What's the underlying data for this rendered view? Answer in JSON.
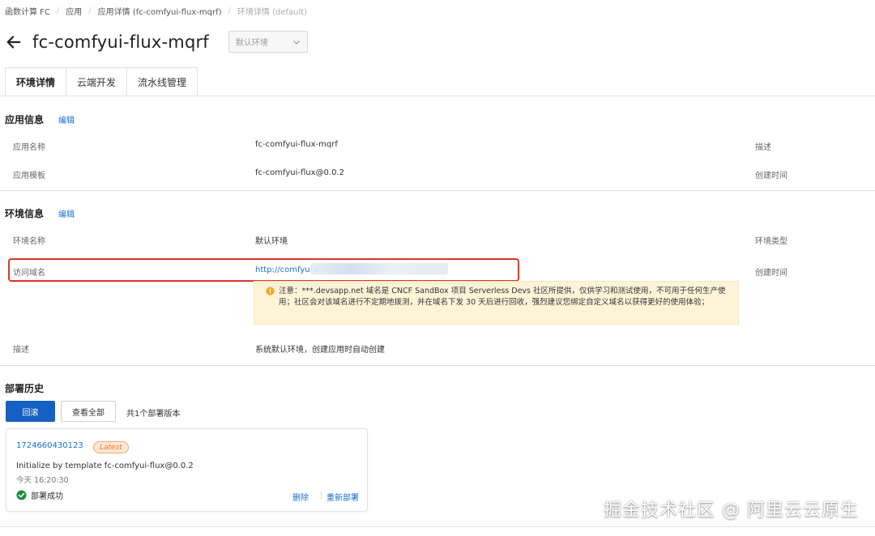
{
  "breadcrumb": {
    "items": [
      "函数计算 FC",
      "应用",
      "应用详情 (fc-comfyui-flux-mqrf)"
    ],
    "current": "环境详情 (default)"
  },
  "header": {
    "title": "fc-comfyui-flux-mqrf",
    "env_select": "默认环境",
    "back_icon": "arrow-left-icon"
  },
  "tabs": [
    {
      "label": "环境详情",
      "active": true
    },
    {
      "label": "云端开发",
      "active": false
    },
    {
      "label": "流水线管理",
      "active": false
    }
  ],
  "app_info": {
    "title": "应用信息",
    "edit": "编辑",
    "name_label": "应用名称",
    "name_value": "fc-comfyui-flux-mqrf",
    "desc_label": "描述",
    "template_label": "应用模板",
    "template_value": "fc-comfyui-flux@0.0.2",
    "created_label": "创建时间"
  },
  "env_info": {
    "title": "环境信息",
    "edit": "编辑",
    "env_name_label": "环境名称",
    "env_name_value": "默认环境",
    "env_type_label": "环境类型",
    "domain_label": "访问域名",
    "domain_value": "http://comfyui-r",
    "created_label": "创建时间",
    "notice": "注意：***.devsapp.net 域名是 CNCF SandBox 项目 Serverless Devs 社区所提供，仅供学习和测试使用，不可用于任何生产使用；社区会对该域名进行不定期地拨测，并在域名下发 30 天后进行回收，强烈建议您绑定自定义域名以获得更好的使用体验；",
    "desc_label": "描述",
    "desc_value": "系统默认环境，创建应用时自动创建"
  },
  "deploy": {
    "title": "部署历史",
    "rollback": "回滚",
    "view_all": "查看全部",
    "count": "共1个部署版本",
    "record": {
      "id": "1724660430123",
      "badge": "Latest",
      "desc": "Initialize by template fc-comfyui-flux@0.0.2",
      "time": "今天 16:20:30",
      "status": "部署成功",
      "delete": "删除",
      "redeploy": "重新部署"
    }
  },
  "watermark": "掘金技术社区 @ 阿里云云原生",
  "colors": {
    "link": "#1a6fd1",
    "primary": "#1560c3",
    "highlight": "#e0322c",
    "notice_bg": "#fdf4d8",
    "success": "#1d8f3e",
    "badge": "#e07a2b"
  }
}
